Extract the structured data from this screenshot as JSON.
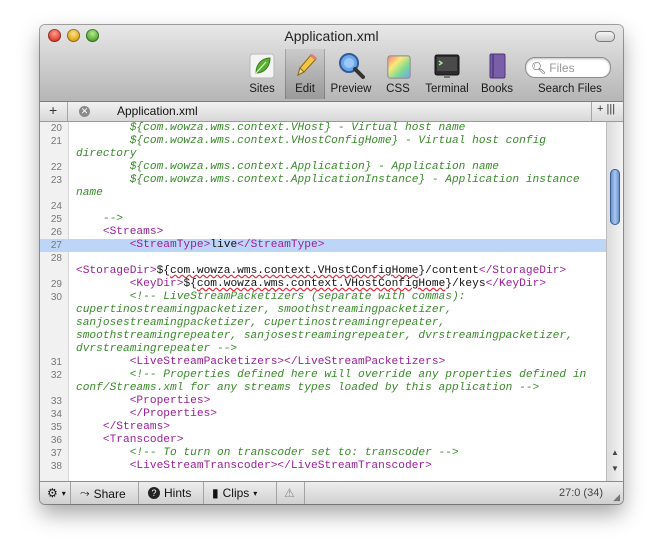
{
  "window": {
    "title": "Application.xml"
  },
  "toolbar": {
    "items": [
      {
        "label": "Sites",
        "icon": "leaf-icon"
      },
      {
        "label": "Edit",
        "icon": "pencil-icon"
      },
      {
        "label": "Preview",
        "icon": "magnifier-icon"
      },
      {
        "label": "CSS",
        "icon": "color-palette-icon"
      },
      {
        "label": "Terminal",
        "icon": "terminal-icon"
      },
      {
        "label": "Books",
        "icon": "book-icon"
      }
    ],
    "search": {
      "placeholder": "Files",
      "label": "Search Files"
    }
  },
  "tabbar": {
    "tab_label": "Application.xml"
  },
  "editor": {
    "lines": [
      {
        "n": "20",
        "html": "<span class=\"c\">        ${com.wowza.wms.context.VHost} - Virtual host name</span>"
      },
      {
        "n": "21",
        "html": "<span class=\"c\">        ${com.wowza.wms.context.VHostConfigHome} - Virtual host config directory</span>"
      },
      {
        "n": "22",
        "html": "<span class=\"c\">        ${com.wowza.wms.context.Application} - Application name</span>"
      },
      {
        "n": "23",
        "html": "<span class=\"c\">        ${com.wowza.wms.context.ApplicationInstance} - Application instance name</span>"
      },
      {
        "n": "24",
        "html": ""
      },
      {
        "n": "25",
        "html": "<span class=\"c\">    --&gt;</span>"
      },
      {
        "n": "26",
        "html": "    <span class=\"t\">&lt;Streams&gt;</span>"
      },
      {
        "n": "27",
        "html": "        <span class=\"t\">&lt;StreamType&gt;</span>live<span class=\"t\">&lt;/StreamType&gt;</span>",
        "hl": true
      },
      {
        "n": "28",
        "html": "        <span class=\"t\">&lt;StorageDir&gt;</span>${<span class=\"u\">com.wowza.wms.context.VHostConfigHome</span>}/content<span class=\"t\">&lt;/StorageDir&gt;</span>"
      },
      {
        "n": "29",
        "html": "        <span class=\"t\">&lt;KeyDir&gt;</span>${<span class=\"u\">com.wowza.wms.context.VHostConfigHome</span>}/keys<span class=\"t\">&lt;/KeyDir&gt;</span>"
      },
      {
        "n": "30",
        "html": "<span class=\"c\">        &lt;!-- LiveStreamPacketizers (separate with commas): cupertinostreamingpacketizer, smoothstreamingpacketizer, sanjosestreamingpacketizer, cupertinostreamingrepeater, smoothstreamingrepeater, sanjosestreamingrepeater, dvrstreamingpacketizer, dvrstreamingrepeater --&gt;</span>"
      },
      {
        "n": "31",
        "html": "        <span class=\"t\">&lt;LiveStreamPacketizers&gt;&lt;/LiveStreamPacketizers&gt;</span>"
      },
      {
        "n": "32",
        "html": "<span class=\"c\">        &lt;!-- Properties defined here will override any properties defined in conf/Streams.xml for any streams types loaded by this application --&gt;</span>"
      },
      {
        "n": "33",
        "html": "        <span class=\"t\">&lt;Properties&gt;</span>"
      },
      {
        "n": "34",
        "html": "        <span class=\"t\">&lt;/Properties&gt;</span>"
      },
      {
        "n": "35",
        "html": "    <span class=\"t\">&lt;/Streams&gt;</span>"
      },
      {
        "n": "36",
        "html": "    <span class=\"t\">&lt;Transcoder&gt;</span>"
      },
      {
        "n": "37",
        "html": "<span class=\"c\">        &lt;!-- To turn on transcoder set to: transcoder --&gt;</span>"
      },
      {
        "n": "38",
        "html": "        <span class=\"t\">&lt;LiveStreamTranscoder&gt;&lt;/LiveStreamTranscoder&gt;</span>"
      }
    ]
  },
  "statusbar": {
    "share_label": "Share",
    "hints_label": "Hints",
    "clips_label": "Clips",
    "position": "27:0 (34)"
  },
  "colors": {
    "highlight": "#bdd6f8",
    "comment": "#3a8a2c",
    "tag": "#9a1e9a"
  }
}
